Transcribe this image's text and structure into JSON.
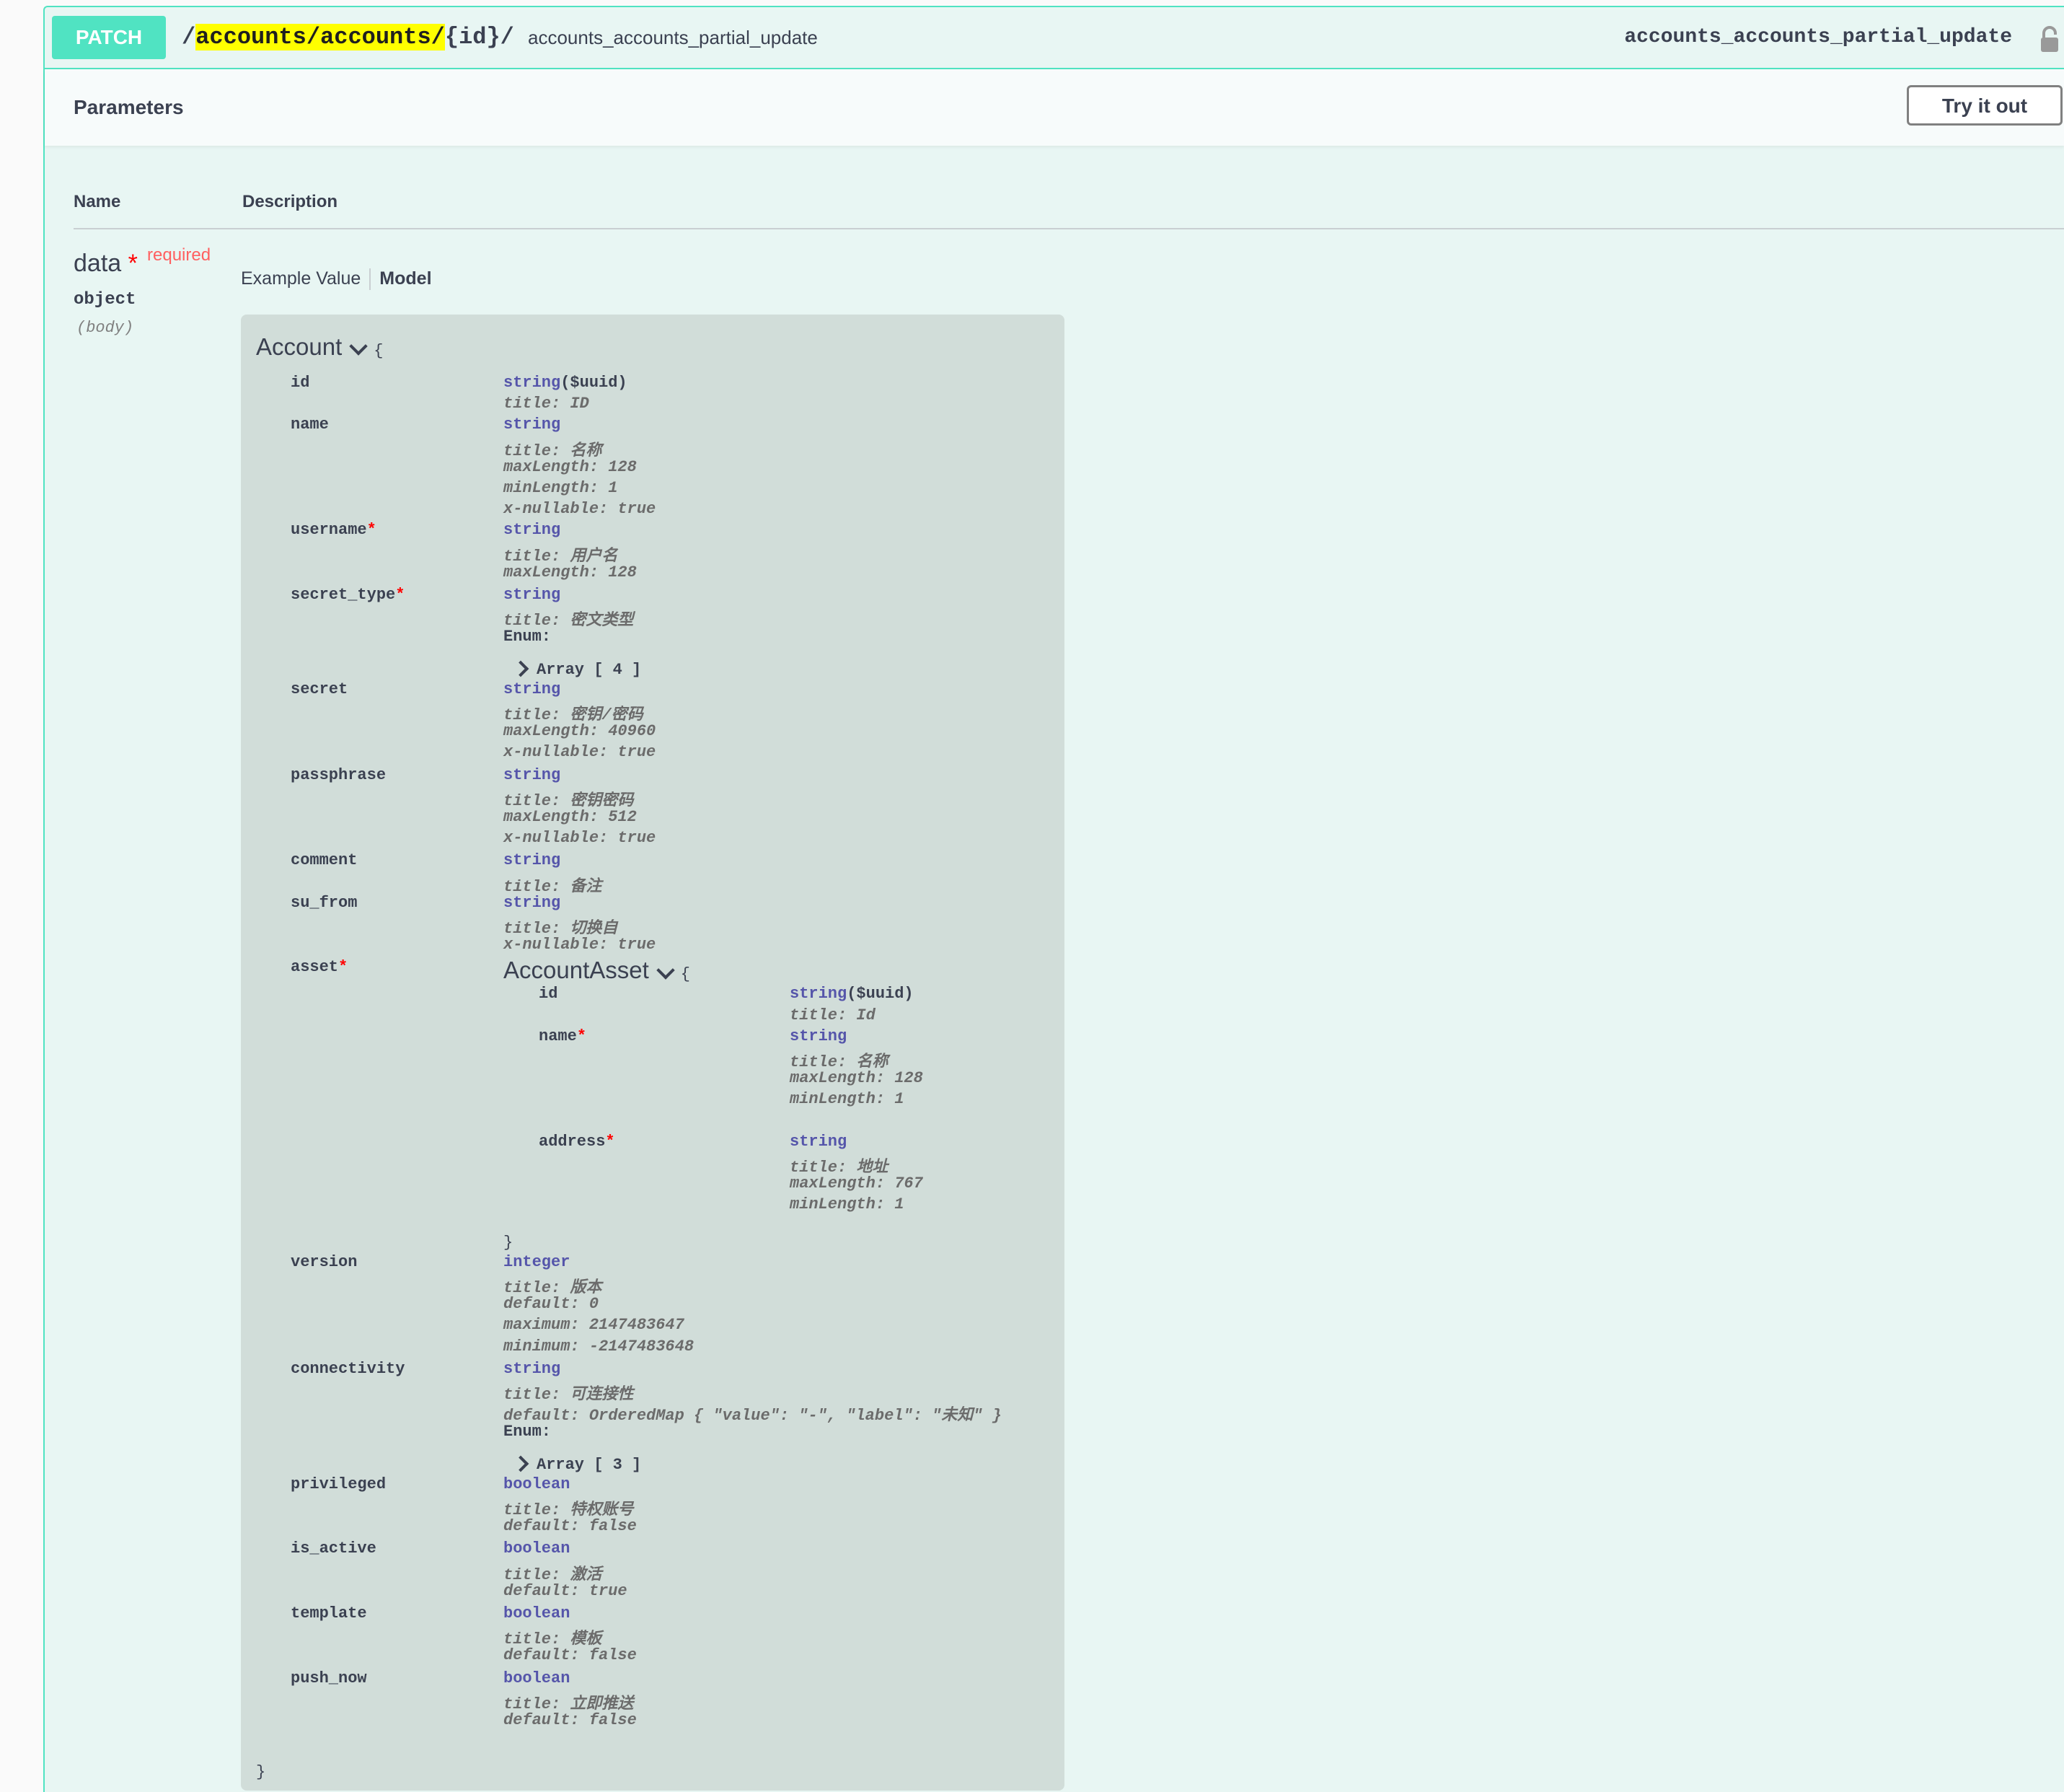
{
  "operation": {
    "method": "PATCH",
    "path_prefix": "/",
    "path_highlight": "accounts/accounts/",
    "path_suffix": "{id}/",
    "description": "accounts_accounts_partial_update",
    "operation_id": "accounts_accounts_partial_update"
  },
  "parameters": {
    "title": "Parameters",
    "try_label": "Try it out",
    "col_name": "Name",
    "col_description": "Description",
    "param": {
      "name": "data",
      "star": "*",
      "required": "required",
      "type": "object",
      "in": "(body)"
    },
    "tabs": {
      "example": "Example Value",
      "model": "Model"
    }
  },
  "model": {
    "name": "Account",
    "open_brace": "{",
    "close_brace": "}",
    "fields": [
      {
        "key": "id",
        "required": false,
        "type": "string",
        "format": "($uuid)",
        "props": [
          "title: ID"
        ]
      },
      {
        "key": "name",
        "required": false,
        "type": "string",
        "props": [
          "title: 名称",
          "maxLength: 128",
          "minLength: 1",
          "x-nullable: true"
        ]
      },
      {
        "key": "username",
        "required": true,
        "type": "string",
        "props": [
          "title: 用户名",
          "maxLength: 128"
        ]
      },
      {
        "key": "secret_type",
        "required": true,
        "type": "string",
        "props": [
          "title: 密文类型"
        ],
        "enum_label": "Enum:",
        "enum_array": "Array [ 4 ]"
      },
      {
        "key": "secret",
        "required": false,
        "type": "string",
        "props": [
          "title: 密钥/密码",
          "maxLength: 40960",
          "x-nullable: true"
        ]
      },
      {
        "key": "passphrase",
        "required": false,
        "type": "string",
        "props": [
          "title: 密钥密码",
          "maxLength: 512",
          "x-nullable: true"
        ]
      },
      {
        "key": "comment",
        "required": false,
        "type": "string",
        "props": [
          "title: 备注"
        ]
      },
      {
        "key": "su_from",
        "required": false,
        "type": "string",
        "props": [
          "title: 切换自",
          "x-nullable: true"
        ]
      },
      {
        "key": "asset",
        "required": true
      },
      {
        "key": "version",
        "required": false,
        "type": "integer",
        "props": [
          "title: 版本",
          "default: 0",
          "maximum: 2147483647",
          "minimum: -2147483648"
        ]
      },
      {
        "key": "connectivity",
        "required": false,
        "type": "string",
        "props": [
          "title: 可连接性",
          "default: OrderedMap { \"value\": \"-\", \"label\": \"未知\" }"
        ],
        "enum_label": "Enum:",
        "enum_array": "Array [ 3 ]"
      },
      {
        "key": "privileged",
        "required": false,
        "type": "boolean",
        "props": [
          "title: 特权账号",
          "default: false"
        ]
      },
      {
        "key": "is_active",
        "required": false,
        "type": "boolean",
        "props": [
          "title: 激活",
          "default: true"
        ]
      },
      {
        "key": "template",
        "required": false,
        "type": "boolean",
        "props": [
          "title: 模板",
          "default: false"
        ]
      },
      {
        "key": "push_now",
        "required": false,
        "type": "boolean",
        "props": [
          "title: 立即推送",
          "default: false"
        ]
      }
    ],
    "nested": {
      "name": "AccountAsset",
      "open_brace": "{",
      "close_brace": "}",
      "fields": [
        {
          "key": "id",
          "required": false,
          "type": "string",
          "format": "($uuid)",
          "props": [
            "title: Id"
          ]
        },
        {
          "key": "name",
          "required": true,
          "type": "string",
          "props": [
            "title: 名称",
            "maxLength: 128",
            "minLength: 1"
          ]
        },
        {
          "key": "address",
          "required": true,
          "type": "string",
          "props": [
            "title: 地址",
            "maxLength: 767",
            "minLength: 1"
          ]
        }
      ]
    }
  },
  "colors": {
    "patch_accent": "#50e3c2",
    "block_bg": "#e8f6f3",
    "model_bg": "#d1ddd9",
    "type_color": "#5555aa",
    "required_color": "#ff0000",
    "highlight": "#ffff00"
  },
  "icons": {
    "lock": "lock-icon",
    "expand": "chevron-down-icon",
    "collapsed": "chevron-right-icon"
  }
}
